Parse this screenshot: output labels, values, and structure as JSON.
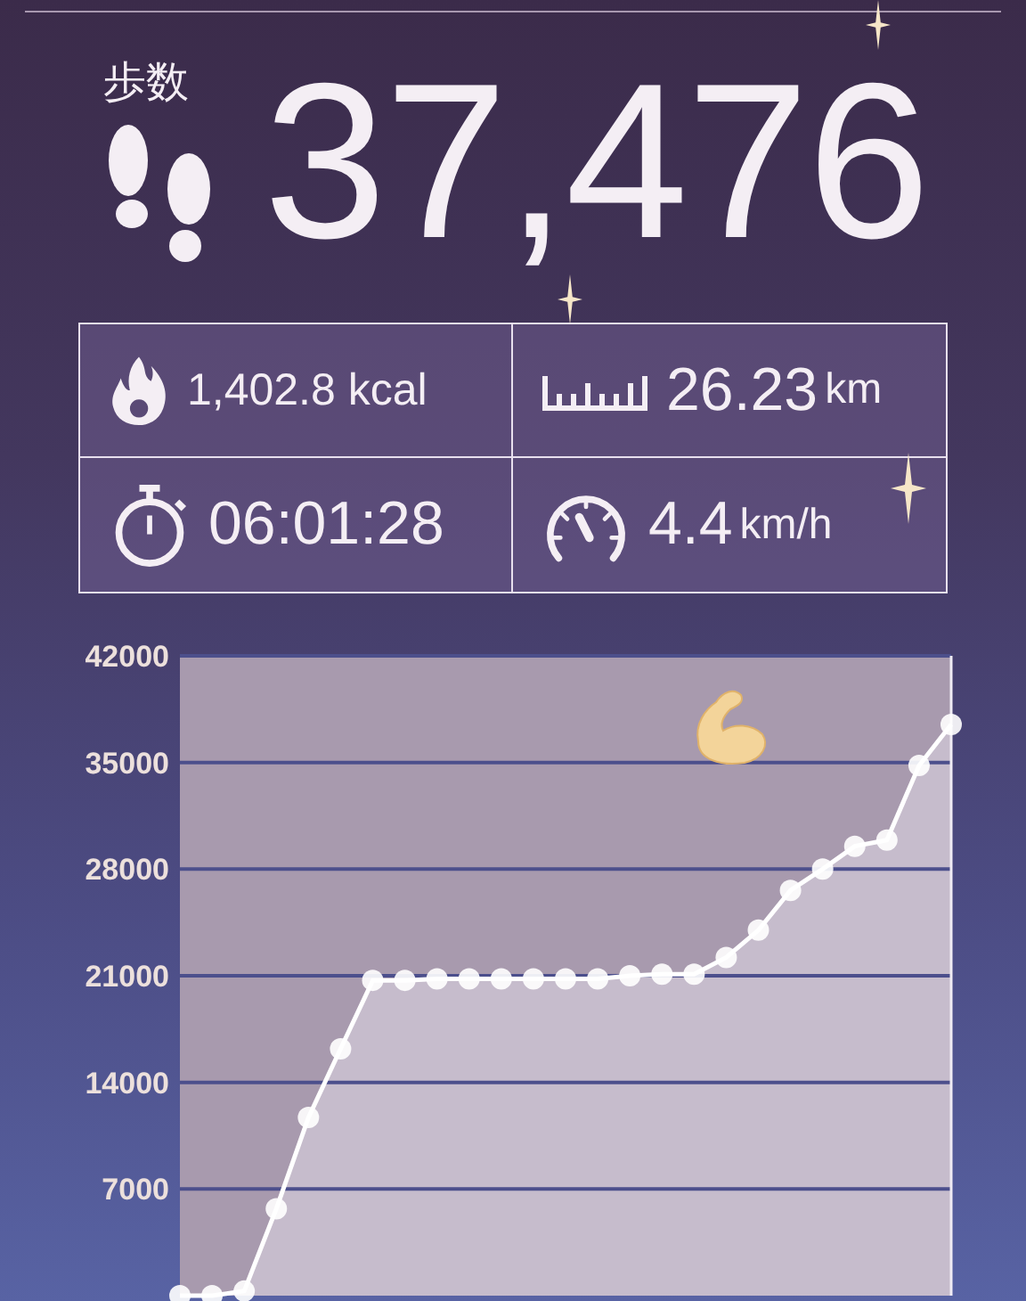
{
  "title": "歩数",
  "steps": "37,476",
  "stats": [
    {
      "kind": "calories",
      "value": "1,402.8 kcal"
    },
    {
      "kind": "distance",
      "value": "26.23",
      "unit": "km"
    },
    {
      "kind": "time",
      "value": "06:01:28"
    },
    {
      "kind": "speed",
      "value": "4.4",
      "unit": "km/h"
    }
  ],
  "chart": {
    "chart_data": {
      "type": "area",
      "ylim": [
        0,
        42000
      ],
      "yticks": [
        7000,
        14000,
        21000,
        28000,
        35000,
        42000
      ],
      "grid": true,
      "series": [
        {
          "color": "#ffffff",
          "marker": "o",
          "values": [
            0,
            0,
            300,
            5700,
            11700,
            16200,
            20700,
            20700,
            20800,
            20800,
            20800,
            20800,
            20800,
            20800,
            21000,
            21100,
            21100,
            22200,
            24000,
            26600,
            28000,
            29500,
            29900,
            34800,
            37500
          ]
        }
      ]
    }
  }
}
